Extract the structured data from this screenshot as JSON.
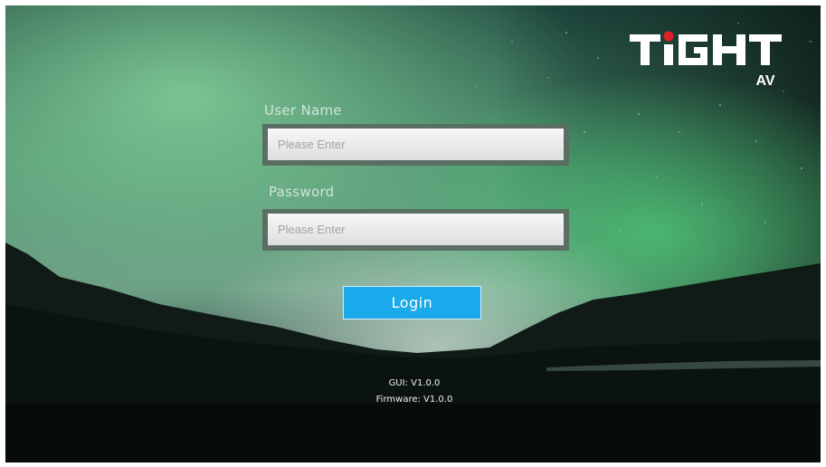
{
  "logo": {
    "brand": "TiGHT",
    "sub": "AV"
  },
  "form": {
    "username_label": "User Name",
    "username_placeholder": "Please Enter",
    "password_label": "Password",
    "password_placeholder": "Please Enter",
    "login_label": "Login"
  },
  "footer": {
    "gui_version": "GUI: V1.0.0",
    "firmware_version": "Firmware: V1.0.0"
  },
  "colors": {
    "login_button": "#1aa9ea",
    "logo_dot": "#e0202a"
  }
}
